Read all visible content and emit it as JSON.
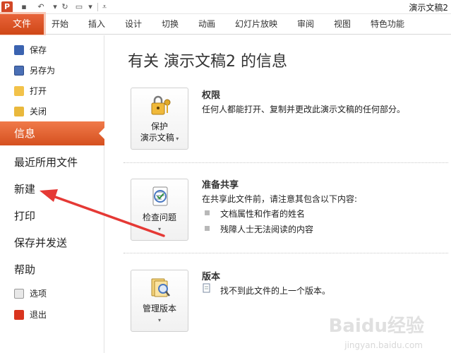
{
  "window": {
    "title": "演示文稿2"
  },
  "ribbon": {
    "file_tab": "文件",
    "tabs": [
      "开始",
      "插入",
      "设计",
      "切换",
      "动画",
      "幻灯片放映",
      "审阅",
      "视图",
      "特色功能"
    ]
  },
  "backstage": {
    "commands": [
      {
        "label": "保存",
        "icon": "save-icon"
      },
      {
        "label": "另存为",
        "icon": "save-as-icon"
      },
      {
        "label": "打开",
        "icon": "open-folder-icon"
      },
      {
        "label": "关闭",
        "icon": "close-folder-icon"
      }
    ],
    "selected": "信息",
    "items": [
      "最近所用文件",
      "新建",
      "打印",
      "保存并发送",
      "帮助"
    ],
    "bottom_commands": [
      {
        "label": "选项",
        "icon": "options-icon"
      },
      {
        "label": "退出",
        "icon": "exit-icon"
      }
    ]
  },
  "info": {
    "heading": "有关 演示文稿2 的信息",
    "permissions": {
      "button_line1": "保护",
      "button_line2": "演示文稿",
      "title": "权限",
      "text": "任何人都能打开、复制并更改此演示文稿的任何部分。"
    },
    "prepare": {
      "button_label": "检查问题",
      "title": "准备共享",
      "text": "在共享此文件前，请注意其包含以下内容:",
      "bullets": [
        "文档属性和作者的姓名",
        "残障人士无法阅读的内容"
      ]
    },
    "versions": {
      "button_label": "管理版本",
      "title": "版本",
      "text": "找不到此文件的上一个版本。"
    }
  },
  "watermark": {
    "brand": "Baidu经验",
    "url": "jingyan.baidu.com"
  },
  "colors": {
    "accent": "#d5501f",
    "annotation_arrow": "#e53935"
  }
}
